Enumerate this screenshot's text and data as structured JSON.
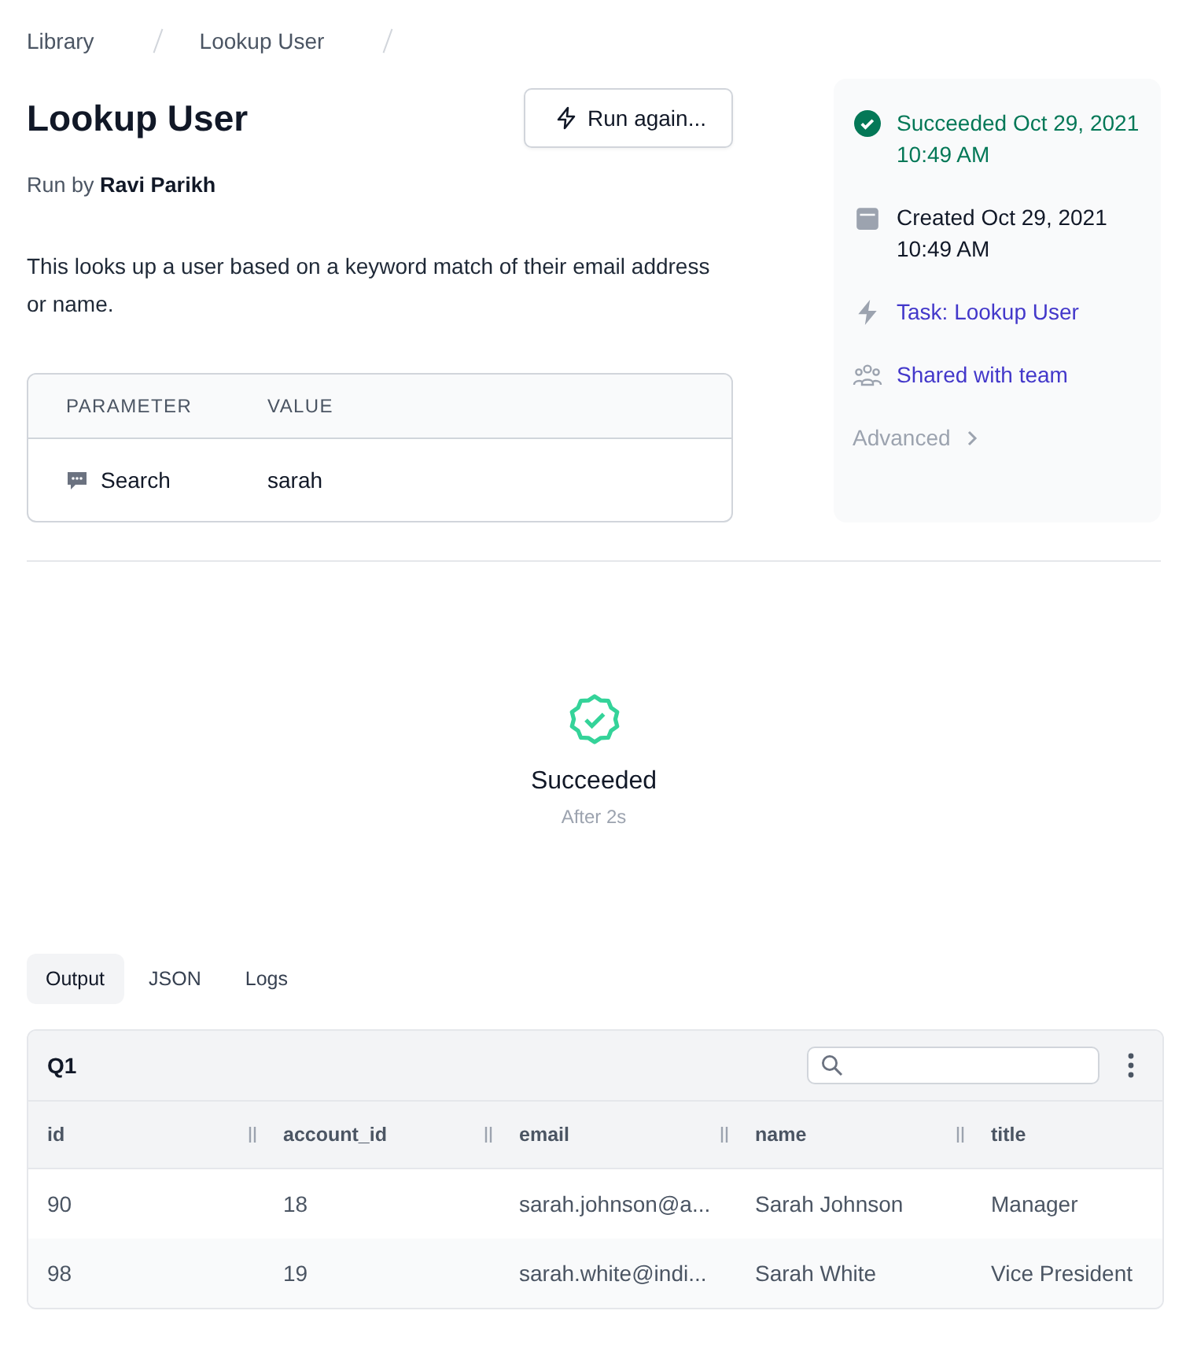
{
  "breadcrumbs": [
    "Library",
    "Lookup User"
  ],
  "title": "Lookup User",
  "run_again_button": "Run again...",
  "run_by": {
    "label": "Run by",
    "name": "Ravi Parikh"
  },
  "description": "This looks up a user based on a keyword match of their email address or name.",
  "parameters": {
    "columns": [
      "PARAMETER",
      "VALUE"
    ],
    "rows": [
      {
        "name": "Search",
        "value": "sarah"
      }
    ]
  },
  "sidebar": {
    "items": [
      {
        "kind": "status",
        "text": "Succeeded Oct 29, 2021 10:49 AM"
      },
      {
        "kind": "created",
        "text": "Created Oct 29, 2021 10:49 AM"
      },
      {
        "kind": "task",
        "text": "Task: Lookup User"
      },
      {
        "kind": "shared",
        "text": "Shared with team"
      },
      {
        "kind": "advanced",
        "text": "Advanced"
      }
    ]
  },
  "run_status": {
    "title": "Succeeded",
    "subtitle": "After 2s"
  },
  "output_tabs": [
    {
      "label": "Output",
      "selected": true
    },
    {
      "label": "JSON",
      "selected": false
    },
    {
      "label": "Logs",
      "selected": false
    }
  ],
  "results": {
    "title": "Q1",
    "columns": [
      "id",
      "account_id",
      "email",
      "name",
      "title"
    ],
    "rows": [
      [
        "90",
        "18",
        "sarah.johnson@a...",
        "Sarah Johnson",
        "Manager"
      ],
      [
        "98",
        "19",
        "sarah.white@indi...",
        "Sarah White",
        "Vice President"
      ]
    ]
  }
}
